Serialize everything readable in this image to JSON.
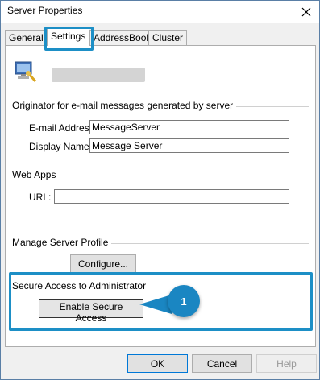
{
  "window": {
    "title": "Server Properties"
  },
  "tabs": [
    {
      "label": "General",
      "active": false
    },
    {
      "label": "Settings",
      "active": true
    },
    {
      "label": "AddressBook",
      "active": false
    },
    {
      "label": "Cluster",
      "active": false
    }
  ],
  "originator": {
    "group_label": "Originator for e-mail messages generated by server",
    "email_label": "E-mail Address:",
    "email_value": "MessageServer",
    "display_label": "Display Name:",
    "display_value": "Message Server"
  },
  "webapps": {
    "group_label": "Web Apps",
    "url_label": "URL:",
    "url_value": ""
  },
  "profile": {
    "group_label": "Manage Server Profile",
    "configure_label": "Configure..."
  },
  "secure": {
    "group_label": "Secure Access to Administrator",
    "button_label": "Enable Secure Access"
  },
  "callout": {
    "number": "1"
  },
  "footer": {
    "ok": "OK",
    "cancel": "Cancel",
    "help": "Help"
  },
  "colors": {
    "highlight": "#1d8fc6",
    "callout": "#1a86c2"
  },
  "icons": {
    "server": "server-monitor-icon",
    "close": "close-icon"
  }
}
